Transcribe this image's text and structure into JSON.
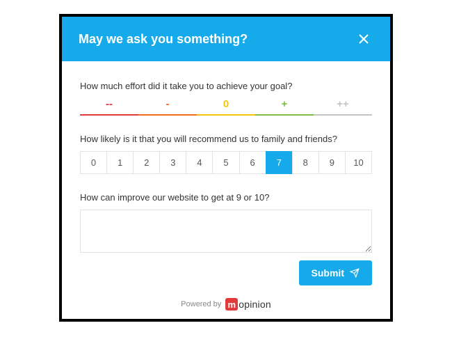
{
  "accent": "#16aaea",
  "logo_bg": "#e03a3a",
  "header": {
    "title": "May we ask you something?"
  },
  "questions": {
    "effort": {
      "label": "How much effort did it take you to achieve your goal?",
      "options": [
        "--",
        "-",
        "0",
        "+",
        "++"
      ],
      "selected": null
    },
    "nps": {
      "label": "How likely is it that you will recommend us to family and friends?",
      "options": [
        "0",
        "1",
        "2",
        "3",
        "4",
        "5",
        "6",
        "7",
        "8",
        "9",
        "10"
      ],
      "selected": 7
    },
    "free": {
      "label": "How can improve our website to get at 9 or 10?",
      "value": ""
    }
  },
  "submit_label": "Submit",
  "powered_by": "Powered by",
  "brand": {
    "m": "m",
    "rest": "opinion"
  }
}
